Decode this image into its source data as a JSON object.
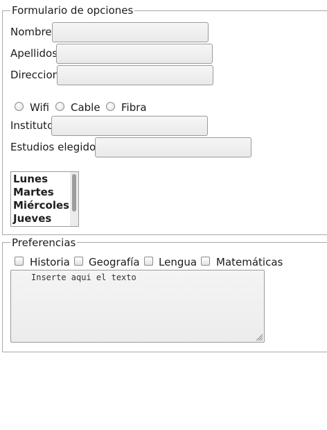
{
  "form": {
    "legend": "Formulario de opciones",
    "fields": {
      "nombre": "Nombre",
      "apellidos": "Apellidos",
      "direccion": "Direccion",
      "instituto": "Instituto",
      "estudios": "Estudios elegidos"
    },
    "connection_options": [
      "Wifi",
      "Cable",
      "Fibra"
    ],
    "days_list": [
      "Lunes",
      "Martes",
      "Miércoles",
      "Jueves"
    ]
  },
  "preferences": {
    "legend": "Preferencias",
    "subjects": [
      "Historia",
      "Geografía",
      "Lengua",
      "Matemáticas"
    ],
    "textarea_text": "Inserte aqui el texto"
  }
}
